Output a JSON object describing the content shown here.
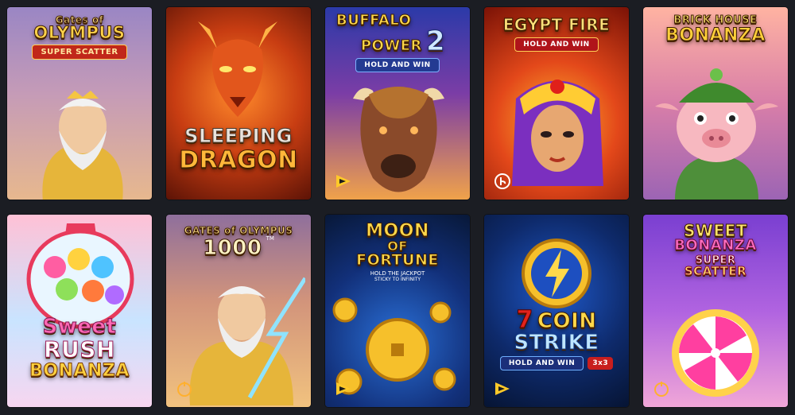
{
  "games": [
    {
      "id": "gates-olympus-super-scatter",
      "line1": "Gates of",
      "line2": "OLYMPUS",
      "sub": "SUPER SCATTER",
      "provider": "pragmatic"
    },
    {
      "id": "sleeping-dragon",
      "line1": "SLEEPING",
      "line2": "DRAGON",
      "provider": "none"
    },
    {
      "id": "buffalo-power-2",
      "line1": "BUFFALO",
      "line2": "POWER",
      "num": "2",
      "sub": "HOLD AND WIN",
      "provider": "playson"
    },
    {
      "id": "egypt-fire",
      "line1": "EGYPT FIRE",
      "sub": "HOLD AND WIN",
      "provider": "booongo"
    },
    {
      "id": "brick-house-bonanza",
      "line1": "BRICK HOUSE",
      "line2": "BONANZA",
      "provider": "none"
    },
    {
      "id": "sweet-rush-bonanza",
      "line1": "Sweet",
      "line2": "RUSH",
      "line3": "BONANZA",
      "provider": "none"
    },
    {
      "id": "gates-olympus-1000",
      "line1": "GATES of OLYMPUS",
      "line2": "1000",
      "tm": "TM",
      "provider": "pragmatic"
    },
    {
      "id": "moon-of-fortune",
      "line1": "MOON",
      "line2": "OF",
      "line3": "FORTUNE",
      "sub": "HOLD THE JACKPOT",
      "sub2": "STICKY TO INFINITY",
      "provider": "playson"
    },
    {
      "id": "coin-strike",
      "num": "7",
      "line1": "COIN",
      "line2": "STRIKE",
      "sub": "HOLD AND WIN",
      "sub2": "3x3",
      "provider": "playson"
    },
    {
      "id": "sweet-bonanza-super-scatter",
      "line1": "SWEET",
      "line2": "BONANZA",
      "sub": "SUPER",
      "sub2": "SCATTER",
      "provider": "pragmatic"
    }
  ]
}
